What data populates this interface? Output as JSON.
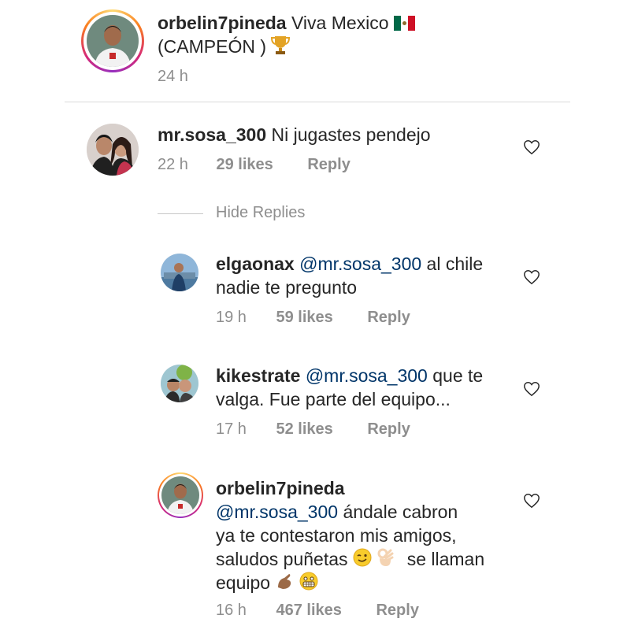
{
  "caption": {
    "username": "orbelin7pineda",
    "text_line1": "Viva Mexico",
    "flag_icon": "mexico-flag-icon",
    "text_line2": "(CAMPEÓN )",
    "trophy_icon": "trophy-icon",
    "time": "24 h"
  },
  "comment": {
    "username": "mr.sosa_300",
    "text": "Ni jugastes pendejo",
    "time": "22 h",
    "likes": "29 likes",
    "reply": "Reply"
  },
  "hide_replies": "Hide Replies",
  "replies": [
    {
      "username": "elgaonax",
      "mention": "@mr.sosa_300",
      "text_line1": "al chile",
      "text_line2": "nadie te pregunto",
      "time": "19 h",
      "likes": "59 likes",
      "reply": "Reply"
    },
    {
      "username": "kikestrate",
      "mention": "@mr.sosa_300",
      "text_line1": "que te",
      "text_line2": "valga. Fue parte del equipo...",
      "time": "17 h",
      "likes": "52 likes",
      "reply": "Reply"
    },
    {
      "username": "orbelin7pineda",
      "mention": "@mr.sosa_300",
      "text_line1": "ándale cabron",
      "text_line2": "ya te contestaron mis amigos,",
      "text_line3": "saludos puñetas",
      "text_line3b": "se llaman",
      "text_line4": "equipo",
      "time": "16 h",
      "likes": "467 likes",
      "reply": "Reply"
    }
  ],
  "colors": {
    "text": "#262626",
    "meta": "#8e8e8e",
    "mention": "#003569"
  }
}
